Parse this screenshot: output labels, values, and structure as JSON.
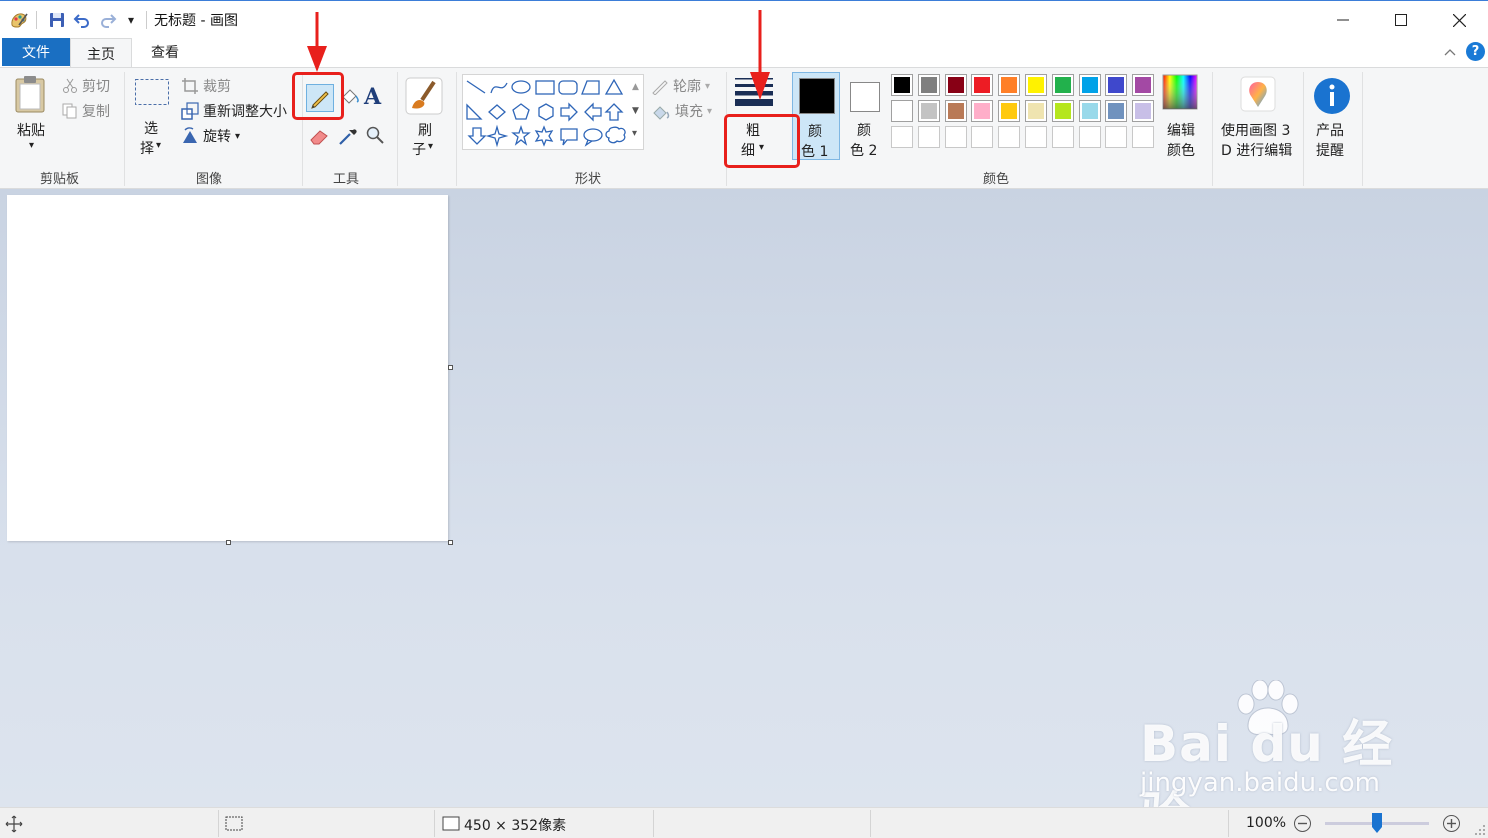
{
  "titlebar": {
    "title": "无标题 - 画图",
    "qa_dropdown": "▾"
  },
  "tabs": {
    "file": "文件",
    "home": "主页",
    "view": "查看",
    "help": "?"
  },
  "ribbon": {
    "clipboard": {
      "paste": "粘贴",
      "cut": "剪切",
      "copy": "复制",
      "label": "剪贴板"
    },
    "image": {
      "select_1": "选",
      "select_2": "择",
      "crop": "裁剪",
      "resize": "重新调整大小",
      "rotate": "旋转",
      "label": "图像"
    },
    "tools": {
      "text_tool": "A",
      "label": "工具"
    },
    "brushes": {
      "line1": "刷",
      "line2": "子",
      "label": ""
    },
    "shapes": {
      "outline": "轮廓",
      "fill": "填充",
      "label": "形状"
    },
    "size": {
      "line1": "粗",
      "line2": "细"
    },
    "colors": {
      "color1_line1": "颜",
      "color1_line2": "色 1",
      "color2_line1": "颜",
      "color2_line2": "色 2",
      "edit_line1": "编辑",
      "edit_line2": "颜色",
      "label": "颜色",
      "color1_value": "#000000",
      "color2_value": "#ffffff",
      "palette_row1": [
        "#000000",
        "#7f7f7f",
        "#880015",
        "#ed1c24",
        "#ff7f27",
        "#fff200",
        "#22b14c",
        "#00a2e8",
        "#3f48cc",
        "#a349a4"
      ],
      "palette_row2": [
        "#ffffff",
        "#c3c3c3",
        "#b97a57",
        "#ffaec9",
        "#ffc90e",
        "#efe4b0",
        "#b5e61d",
        "#99d9ea",
        "#7092be",
        "#c8bfe7"
      ]
    },
    "paint3d": {
      "line1": "使用画图 3",
      "line2": "D 进行编辑"
    },
    "product": {
      "line1": "产品",
      "line2": "提醒"
    }
  },
  "status": {
    "dimensions": "450 × 352像素",
    "zoom": "100%",
    "zoom_level": 0.5
  },
  "watermark": {
    "main": "Bai du 经验",
    "sub": "jingyan.baidu.com"
  },
  "accent": "#1a6fc2"
}
